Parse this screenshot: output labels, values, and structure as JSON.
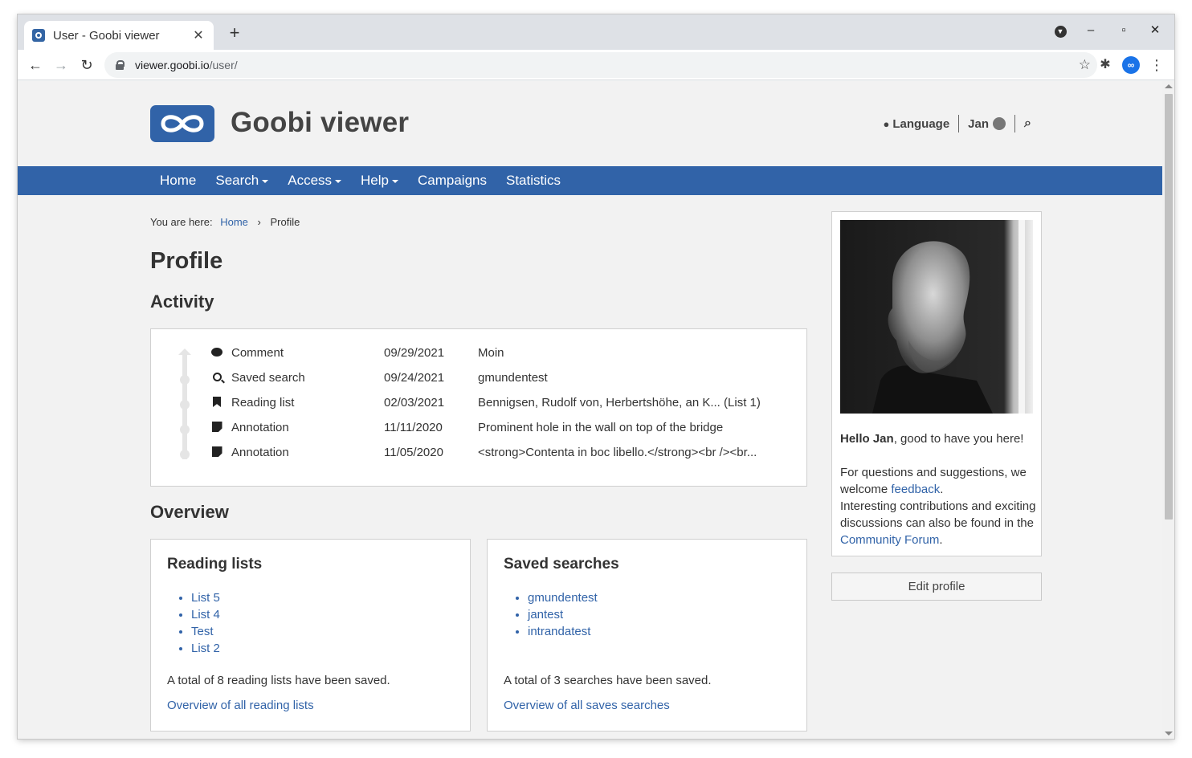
{
  "browser": {
    "tab_title": "User - Goobi viewer",
    "url_host": "viewer.goobi.io",
    "url_path": "/user/"
  },
  "header": {
    "site_title": "Goobi viewer",
    "language_label": "Language",
    "user_label": "Jan"
  },
  "nav": {
    "items": [
      {
        "label": "Home",
        "has_dropdown": false
      },
      {
        "label": "Search",
        "has_dropdown": true
      },
      {
        "label": "Access",
        "has_dropdown": true
      },
      {
        "label": "Help",
        "has_dropdown": true
      },
      {
        "label": "Campaigns",
        "has_dropdown": false
      },
      {
        "label": "Statistics",
        "has_dropdown": false
      }
    ]
  },
  "breadcrumb": {
    "prefix": "You are here:",
    "home": "Home",
    "current": "Profile"
  },
  "page": {
    "title": "Profile",
    "activity_heading": "Activity",
    "overview_heading": "Overview"
  },
  "activity": [
    {
      "icon": "comment-icon",
      "type": "Comment",
      "date": "09/29/2021",
      "description": "Moin"
    },
    {
      "icon": "search-icon",
      "type": "Saved search",
      "date": "09/24/2021",
      "description": "gmundentest"
    },
    {
      "icon": "bookmark-icon",
      "type": "Reading list",
      "date": "02/03/2021",
      "description": "Bennigsen, Rudolf von, Herbertshöhe, an K... (List 1)"
    },
    {
      "icon": "note-icon",
      "type": "Annotation",
      "date": "11/11/2020",
      "description": "Prominent hole in the wall on top of the bridge"
    },
    {
      "icon": "note-icon",
      "type": "Annotation",
      "date": "11/05/2020",
      "description": "<strong>Contenta in boc libello.</strong><br /><br..."
    }
  ],
  "reading_lists": {
    "title": "Reading lists",
    "items": [
      "List 5",
      "List 4",
      "Test",
      "List 2"
    ],
    "total": "A total of 8 reading lists have been saved.",
    "more_link": "Overview of all reading lists"
  },
  "saved_searches": {
    "title": "Saved searches",
    "items": [
      "gmundentest",
      "jantest",
      "intrandatest"
    ],
    "total": "A total of 3 searches have been saved.",
    "more_link": "Overview of all saves searches"
  },
  "sidebar": {
    "greeting_name": "Hello Jan",
    "greeting_rest": ", good to have you here!",
    "questions_text": "For questions and suggestions, we welcome ",
    "feedback_link": "feedback",
    "period": ".",
    "contrib_text": "Interesting contributions and exciting discussions can also be found in the ",
    "forum_link": "Community Forum",
    "edit_button": "Edit profile"
  },
  "colors": {
    "brand": "#3163a8",
    "page_bg": "#f2f2f2"
  }
}
